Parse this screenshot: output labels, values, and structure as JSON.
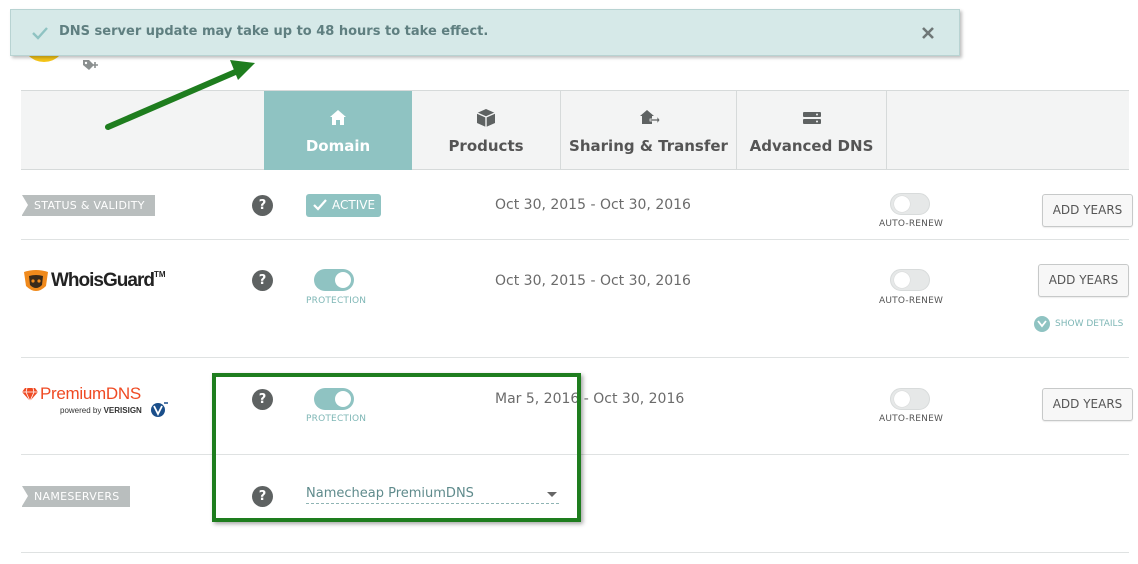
{
  "notification": {
    "message": "DNS server update may take up to 48 hours to take effect.",
    "icon": "check-icon",
    "close_icon": "close-icon"
  },
  "tabs": [
    {
      "label": "Domain",
      "icon": "home-icon",
      "active": true
    },
    {
      "label": "Products",
      "icon": "box-icon",
      "active": false
    },
    {
      "label": "Sharing & Transfer",
      "icon": "transfer-icon",
      "active": false
    },
    {
      "label": "Advanced DNS",
      "icon": "server-icon",
      "active": false
    }
  ],
  "status": {
    "section_label": "STATUS & VALIDITY",
    "badge": "ACTIVE",
    "dates": "Oct 30, 2015 - Oct 30, 2016",
    "autorenew_label": "AUTO-RENEW",
    "autorenew_on": false,
    "button": "ADD YEARS"
  },
  "whoisguard": {
    "logo_text": "WhoisGuard",
    "logo_tm": "TM",
    "protection_label": "PROTECTION",
    "protection_on": true,
    "dates": "Oct 30, 2015 - Oct 30, 2016",
    "autorenew_label": "AUTO-RENEW",
    "autorenew_on": false,
    "button": "ADD YEARS",
    "show_details": "SHOW DETAILS"
  },
  "premiumdns": {
    "logo_text": "PremiumDNS",
    "powered_by": "powered by",
    "verisign": "VERISIGN",
    "protection_label": "PROTECTION",
    "protection_on": true,
    "dates": "Mar 5, 2016 - Oct 30, 2016",
    "autorenew_label": "AUTO-RENEW",
    "autorenew_on": false,
    "button": "ADD YEARS"
  },
  "nameservers": {
    "section_label": "NAMESERVERS",
    "selected": "Namecheap PremiumDNS"
  },
  "help_glyph": "?",
  "colors": {
    "accent_teal": "#8fc3c2",
    "notice_bg": "#d6e9e8",
    "highlight_green": "#1e7d1e",
    "premiumdns_orange": "#ef4a23"
  }
}
